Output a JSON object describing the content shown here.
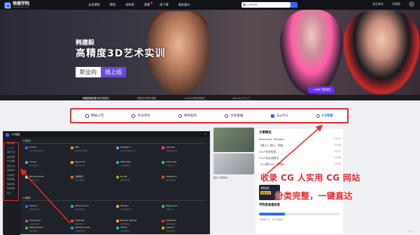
{
  "nav": {
    "logo_cn": "琅搜学院",
    "logo_en": "shousoucn.com",
    "links": [
      "全部课程",
      "教程",
      "训练营",
      "直播",
      "线下课",
      "服务窗口"
    ],
    "search_placeholder": "已有检索",
    "right": [
      "关注有礼",
      "开通会"
    ]
  },
  "hero": {
    "name": "韩建毅",
    "title": "高精度3D艺术实训",
    "tag1": "职业向",
    "tag2": "线上班",
    "cta": "一分钟了解我们"
  },
  "substrip": [
    "韩建毅高精度3D艺术实训",
    "零基础3D美术课程",
    "Houdini特效训练营",
    "Blender 3D入门"
  ],
  "announcements": [
    {
      "icon": "document-icon",
      "label": "网站公告"
    },
    {
      "icon": "star-icon",
      "label": "学员评价"
    },
    {
      "icon": "person-icon",
      "label": "导师名师"
    },
    {
      "icon": "mic-icon",
      "label": "大师直播"
    },
    {
      "icon": "surfcg-icon",
      "label": "SurfCG"
    },
    {
      "icon": "compass-icon",
      "label": "CG导航"
    }
  ],
  "news": {
    "title": "文章精选",
    "items": [
      {
        "text": "Marmoset Toolbag...",
        "date": "02/16"
      },
      {
        "text": "《跨入》排行，你知...",
        "date": "02/08"
      },
      {
        "text": "CG人在学校里...",
        "date": "02/07"
      },
      {
        "text": "CG人员实战就业...",
        "date": "02/08"
      },
      {
        "text": "《CG是什么》这两件...",
        "date": "02/09"
      }
    ],
    "promo_card_a": "学院讲堂",
    "promo_card_b": "直播讲堂",
    "promo_title": "学院是直播讲堂",
    "progress": 0.32,
    "promo_sub": "开课第1天 · 共5节直播"
  },
  "thumbs": {
    "caption": "数字人像美术"
  },
  "footer_page": "1 / 1",
  "navsite": {
    "title": "CG导航",
    "sidebar": [
      "推荐站点",
      "CG资讯",
      "模型下载",
      "素材资源",
      "学习教程",
      "插件工具",
      "灵感参考",
      "作品展示",
      "招聘求职",
      "院校机构",
      "软件官网",
      "其它"
    ],
    "section1": "CG资讯",
    "section2": "CG素材",
    "items_row1": [
      {
        "name": "Surfcg",
        "desc": "专业CG资讯聚合站",
        "color": "#2f6bff"
      },
      {
        "name": "80lv",
        "desc": "游戏美术资讯网站",
        "color": "#ff8a3d"
      },
      {
        "name": "Artstation",
        "desc": "全球CG作品展示平台",
        "color": "#4ea1ff"
      },
      {
        "name": "cgtrader",
        "desc": "3D模型交易社区",
        "color": "#ff4b4b"
      }
    ],
    "items_row2": [
      {
        "name": "Unreal",
        "desc": "虚幻引擎官方",
        "color": "#8a8f97"
      },
      {
        "name": "Polycount",
        "desc": "游戏美术论坛",
        "color": "#ffb400"
      },
      {
        "name": "Sketchfab",
        "desc": "三维模型展示",
        "color": "#1caad9"
      },
      {
        "name": "CGSociety",
        "desc": "CG社区门户",
        "color": "#26c281"
      }
    ],
    "items_row3": [
      {
        "name": "Zbrushcentral",
        "desc": "雕刻作品交流",
        "color": "#e6e6e6"
      },
      {
        "name": "火星时代",
        "desc": "数字艺术教育",
        "color": "#ff6a00"
      },
      {
        "name": "Nvidia",
        "desc": "图形技术资讯",
        "color": "#76b900"
      },
      {
        "name": "Substance",
        "desc": "材质工具官网",
        "color": "#d94c2b"
      }
    ],
    "items_row4": [
      {
        "name": "Texture",
        "desc": "纹理素材下载",
        "color": "#2f6bff"
      },
      {
        "name": "Textures.com",
        "desc": "高清贴图资源",
        "color": "#3aa3e3"
      },
      {
        "name": "Poliigon",
        "desc": "PBR材质资源库",
        "color": "#e9a23b"
      },
      {
        "name": "Megascans",
        "desc": "扫描资产库",
        "color": "#22c55e"
      }
    ],
    "items_row5": [
      {
        "name": "Turbosquid",
        "desc": "三维模型市场",
        "color": "#9b59b6"
      },
      {
        "name": "CGModel",
        "desc": "模型素材平台",
        "color": "#ff4b4b"
      },
      {
        "name": "Blender Market",
        "desc": "插件素材商店",
        "color": "#f5a623"
      },
      {
        "name": "Kitbash3d",
        "desc": "场景拼装套件",
        "color": "#e52a2a"
      }
    ],
    "items_row6": [
      {
        "name": "Kitbashing3d",
        "desc": "硬表面拼装",
        "color": "#4caf50"
      },
      {
        "name": "affinitymodels",
        "desc": "人物模型资源",
        "color": "#2196f3"
      },
      {
        "name": "3DSky",
        "desc": "室内模型素材",
        "color": "#00bcd4"
      },
      {
        "name": "cgpeers",
        "desc": "资源分享社区",
        "color": "#ff9800"
      }
    ]
  },
  "annotation": {
    "line1": "收录 CG 人实用 CG 网站",
    "line2": "分类完整，一键直达",
    "color": "#e52a2a"
  }
}
